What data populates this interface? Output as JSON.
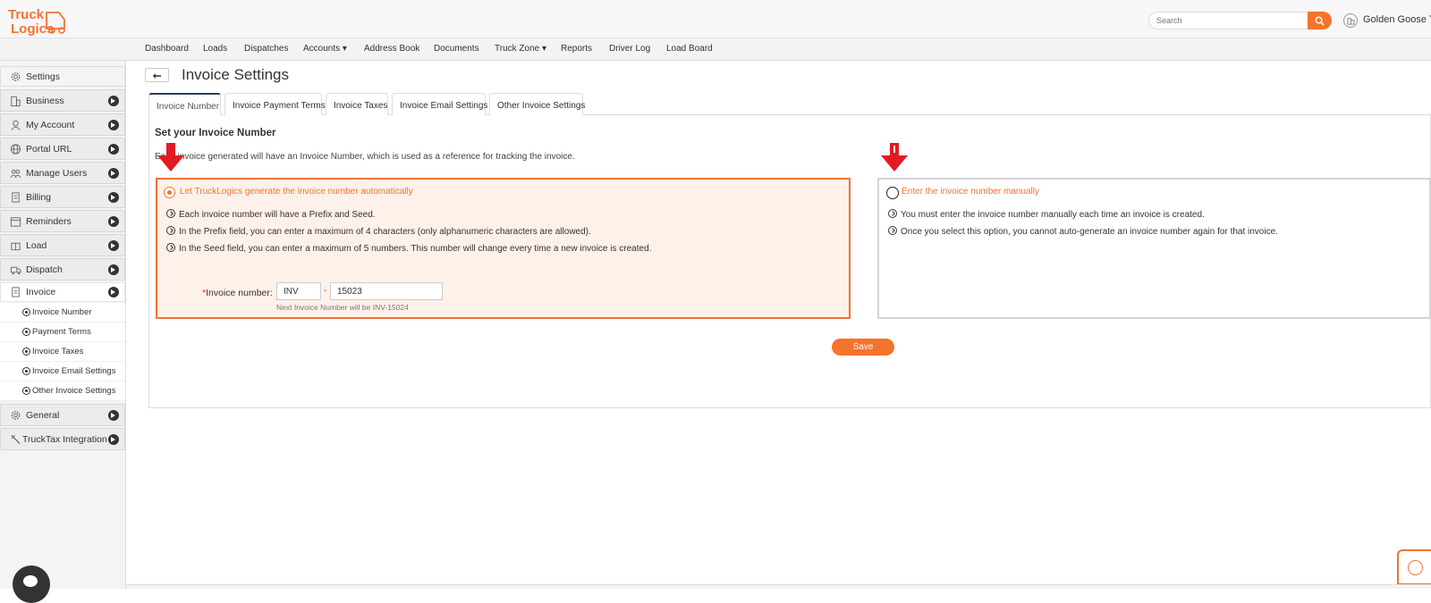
{
  "app": {
    "logo_line1": "Truck",
    "logo_line2": "Logics",
    "search_placeholder": "Search",
    "company_name": "Golden Goose Tr",
    "accent_color": "#f5732a"
  },
  "nav": [
    "Dashboard",
    "Loads",
    "Dispatches",
    "Accounts ▾",
    "Address Book",
    "Documents",
    "Truck Zone ▾",
    "Reports",
    "Driver Log",
    "Load Board"
  ],
  "sidebar": {
    "header": "Settings",
    "items": [
      {
        "label": "Business",
        "icon": "building-icon"
      },
      {
        "label": "My Account",
        "icon": "user-icon"
      },
      {
        "label": "Portal URL",
        "icon": "globe-icon"
      },
      {
        "label": "Manage Users",
        "icon": "users-icon"
      },
      {
        "label": "Billing",
        "icon": "receipt-icon"
      },
      {
        "label": "Reminders",
        "icon": "calendar-icon"
      },
      {
        "label": "Load",
        "icon": "box-icon"
      },
      {
        "label": "Dispatch",
        "icon": "dispatch-icon"
      },
      {
        "label": "Invoice",
        "icon": "invoice-icon"
      }
    ],
    "invoice_sub": [
      "Invoice Number",
      "Payment Terms",
      "Invoice Taxes",
      "Invoice Email Settings",
      "Other Invoice Settings"
    ],
    "after": [
      {
        "label": "General",
        "icon": "gear-icon"
      },
      {
        "label": "TruckTax Integration",
        "icon": "tools-icon"
      }
    ]
  },
  "page": {
    "title": "Invoice Settings",
    "tabs": [
      "Invoice Number",
      "Invoice Payment Terms",
      "Invoice Taxes",
      "Invoice Email Settings",
      "Other Invoice Settings"
    ],
    "section_title": "Set your Invoice Number",
    "description": "Each invoice generated will have an Invoice Number, which is used as a reference for tracking the invoice.",
    "auto_option": {
      "label": "Let TruckLogics generate the invoice number automatically",
      "selected": true,
      "bullets": [
        "Each invoice number will have a Prefix and Seed.",
        "In the Prefix field, you can enter a maximum of 4 characters (only alphanumeric characters are allowed).",
        "In the Seed field, you can enter a maximum of 5 numbers. This number will change every time a new invoice is created."
      ],
      "field_label": "Invoice number:",
      "required_mark": "*",
      "prefix": "INV",
      "separator": "-",
      "seed": "15023",
      "next_note": "Next Invoice Number will be INV-15024"
    },
    "manual_option": {
      "label": "Enter the invoice number manually",
      "selected": false,
      "bullets": [
        "You must enter the invoice number manually each time an invoice is created.",
        "Once you select this option, you cannot auto-generate an invoice number again for that invoice."
      ]
    },
    "save_label": "Save"
  }
}
